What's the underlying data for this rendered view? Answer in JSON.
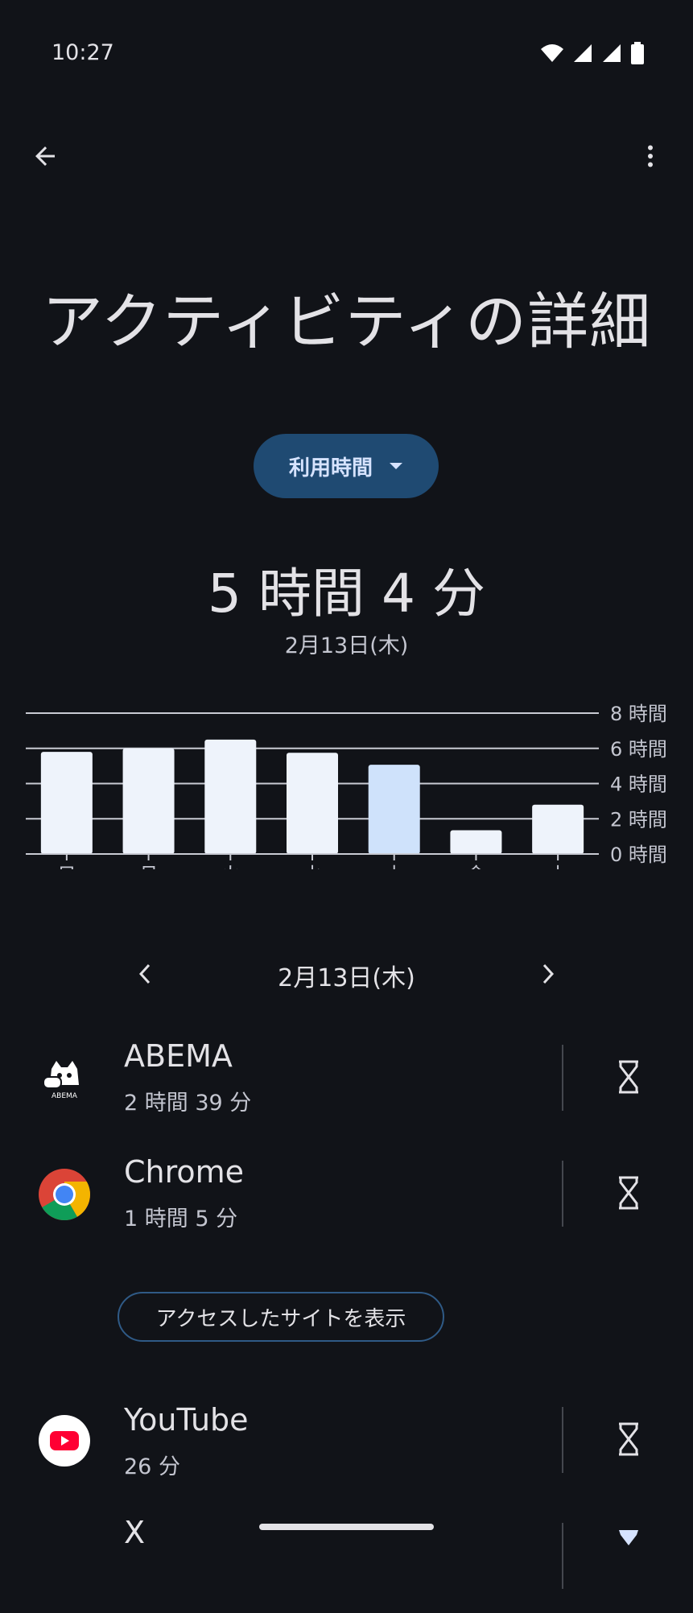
{
  "status_bar": {
    "time": "10:27"
  },
  "header": {
    "title": "アクティビティの詳細"
  },
  "metric_dropdown": {
    "label": "利用時間"
  },
  "summary": {
    "total": "5 時間 4 分",
    "date": "2月13日(木)"
  },
  "colors": {
    "background": "#111318",
    "bar": "#eef3fb",
    "bar_selected": "#cfe2fb",
    "accent": "#1f4a72",
    "grid": "#c9cbd3"
  },
  "chart_data": {
    "type": "bar",
    "categories": [
      "日",
      "月",
      "火",
      "水",
      "木",
      "金",
      "土"
    ],
    "values": [
      5.8,
      6.0,
      6.5,
      5.75,
      5.07,
      1.35,
      2.8
    ],
    "selected_index": 4,
    "y_ticks": [
      "0 時間",
      "2 時間",
      "4 時間",
      "6 時間",
      "8 時間"
    ],
    "ylim": [
      0,
      8
    ],
    "grid": true
  },
  "date_nav": {
    "label": "2月13日(木)"
  },
  "apps": [
    {
      "name": "ABEMA",
      "time": "2 時間 39 分",
      "icon": "abema-icon"
    },
    {
      "name": "Chrome",
      "time": "1 時間 5 分",
      "icon": "chrome-icon"
    },
    {
      "name": "YouTube",
      "time": "26 分",
      "icon": "youtube-icon"
    },
    {
      "name": "X",
      "time": "",
      "icon": "x-icon"
    }
  ],
  "sites_button": {
    "label": "アクセスしたサイトを表示"
  }
}
